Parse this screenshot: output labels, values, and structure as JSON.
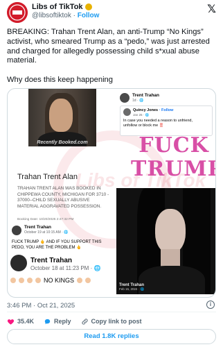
{
  "tweet": {
    "display_name": "Libs of TikTok",
    "handle": "@libsoftiktok",
    "follow_label": "Follow",
    "text_line1": "BREAKING: Trahan Trent Alan, an anti-Trump “No Kings” activist, who smeared Trump as a “pedo,” was just arrested and charged for allegedly possessing child s*xual abuse material.",
    "text_line2": "Why does this keep happening",
    "timestamp": "3:46 PM · Oct 21, 2025",
    "like_count": "35.4K",
    "reply_label": "Reply",
    "copy_link_label": "Copy link to post",
    "read_replies_label": "Read 1.8K replies",
    "brand_color": "#d21b2a",
    "link_color": "#1d9bf0"
  },
  "media": {
    "mugshot_caption": "Recently Booked.com",
    "fb_post": {
      "name": "Trent Trahan",
      "sub": "1d · ",
      "shared_name": "Quincy Jones",
      "shared_follow": " · Follow",
      "shared_sub": "Jan 26 · ",
      "shared_text": "In case you needed a reason to unfriend, unfollow or block me ‼️"
    },
    "big_text_1": "FUCK",
    "big_text_2": "TRUMP",
    "big_text_color": "#d84fa6",
    "watermark_text": "Libs of TikTok",
    "info_title": "Trahan Trent Alan",
    "info_body": "TRAHAN TRENT ALAN WAS BOOKED IN CHIPPEWA COUNTY, MICHIGAN FOR 3710 - 37000--CHILD SEXUALLY ABUSIVE MATERIAL AGGRAVATED POSSESSION.",
    "info_date": "Booking Date: 10/20/2025 2:47:32 PM",
    "portrait_name": "Trent Trahan",
    "portrait_date": "Feb 15, 2024 · ",
    "fb_post2": {
      "name": "Trent Trahan",
      "date": "October 19 at 10:15 AM · ",
      "text": "FUCK TRUMP 🖕 AND IF YOU SUPPORT THIS PEDO, YOU ARE THE PROBLEM 🖕"
    },
    "fb_post3": {
      "name": "Trent Trahan",
      "date": "October 18 at 11:23 PM · ",
      "text": "NO KINGS"
    }
  }
}
